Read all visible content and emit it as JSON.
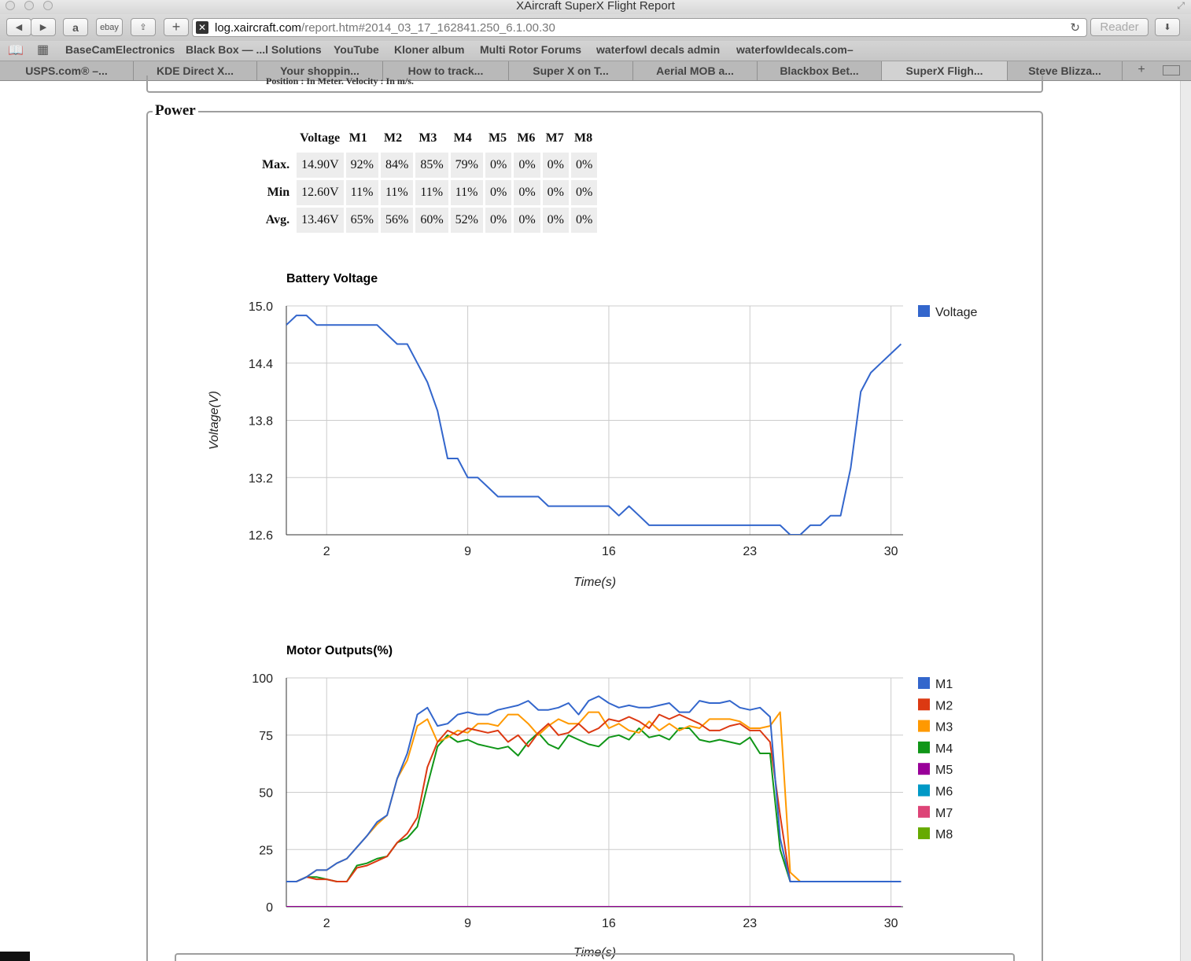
{
  "window": {
    "title": "XAircraft SuperX Flight Report"
  },
  "toolbar": {
    "amazon_label": "a",
    "ebay_label": "ebay",
    "url_host": "log.xaircraft.com",
    "url_rest": "/report.htm#2014_03_17_162841.250_6.1.00.30",
    "reader_label": "Reader"
  },
  "bookmarks": [
    "BaseCamElectronics",
    "Black Box — ...l Solutions",
    "YouTube",
    "Kloner album",
    "Multi Rotor Forums",
    "waterfowl decals admin",
    "waterfowldecals.com–"
  ],
  "tabs": [
    "USPS.com® –...",
    "KDE Direct X...",
    "Your shoppin...",
    "How to track...",
    "Super X on T...",
    "Aerial MOB a...",
    "Blackbox Bet...",
    "SuperX Fligh...",
    "Steve Blizza..."
  ],
  "prev_section_text": "Position : In Meter.     Velocity : In m/s.",
  "power": {
    "legend": "Power",
    "table": {
      "headers": [
        "Voltage",
        "M1",
        "M2",
        "M3",
        "M4",
        "M5",
        "M6",
        "M7",
        "M8"
      ],
      "rows": [
        {
          "label": "Max.",
          "cells": [
            "14.90V",
            "92%",
            "84%",
            "85%",
            "79%",
            "0%",
            "0%",
            "0%",
            "0%"
          ]
        },
        {
          "label": "Min",
          "cells": [
            "12.60V",
            "11%",
            "11%",
            "11%",
            "11%",
            "0%",
            "0%",
            "0%",
            "0%"
          ]
        },
        {
          "label": "Avg.",
          "cells": [
            "13.46V",
            "65%",
            "56%",
            "60%",
            "52%",
            "0%",
            "0%",
            "0%",
            "0%"
          ]
        }
      ]
    }
  },
  "chart_data": [
    {
      "type": "line",
      "title": "Battery Voltage",
      "xlabel": "Time(s)",
      "ylabel": "Voltage(V)",
      "xlim": [
        0,
        30.6
      ],
      "ylim": [
        12.6,
        15.0
      ],
      "xticks": [
        2,
        9,
        16,
        23,
        30
      ],
      "yticks": [
        12.6,
        13.2,
        13.8,
        14.4,
        15.0
      ],
      "grid": true,
      "legend_position": "right",
      "series": [
        {
          "name": "Voltage",
          "color": "#3366cc",
          "x": [
            0,
            0.5,
            1,
            1.5,
            2,
            2.5,
            3,
            3.5,
            4,
            4.5,
            5,
            5.5,
            6,
            6.5,
            7,
            7.5,
            8,
            8.5,
            9,
            9.5,
            10,
            10.5,
            11,
            11.5,
            12,
            12.5,
            13,
            13.5,
            14,
            14.5,
            15,
            15.5,
            16,
            16.5,
            17,
            17.5,
            18,
            18.5,
            19,
            19.5,
            20,
            20.5,
            21,
            21.5,
            22,
            22.5,
            23,
            23.5,
            24,
            24.5,
            25,
            25.5,
            26,
            26.5,
            27,
            27.5,
            28,
            28.5,
            29,
            29.5,
            30,
            30.5
          ],
          "y": [
            14.8,
            14.9,
            14.9,
            14.8,
            14.8,
            14.8,
            14.8,
            14.8,
            14.8,
            14.8,
            14.7,
            14.6,
            14.6,
            14.4,
            14.2,
            13.9,
            13.4,
            13.4,
            13.2,
            13.2,
            13.1,
            13.0,
            13.0,
            13.0,
            13.0,
            13.0,
            12.9,
            12.9,
            12.9,
            12.9,
            12.9,
            12.9,
            12.9,
            12.8,
            12.9,
            12.8,
            12.7,
            12.7,
            12.7,
            12.7,
            12.7,
            12.7,
            12.7,
            12.7,
            12.7,
            12.7,
            12.7,
            12.7,
            12.7,
            12.7,
            12.6,
            12.6,
            12.7,
            12.7,
            12.8,
            12.8,
            13.3,
            14.1,
            14.3,
            14.4,
            14.5,
            14.6
          ]
        }
      ]
    },
    {
      "type": "line",
      "title": "Motor Outputs(%)",
      "xlabel": "Time(s)",
      "ylabel": "",
      "xlim": [
        0,
        30.6
      ],
      "ylim": [
        0,
        100
      ],
      "xticks": [
        2,
        9,
        16,
        23,
        30
      ],
      "yticks": [
        0,
        25,
        50,
        75,
        100
      ],
      "grid": true,
      "legend_position": "right",
      "x": [
        0,
        0.5,
        1,
        1.5,
        2,
        2.5,
        3,
        3.5,
        4,
        4.5,
        5,
        5.5,
        6,
        6.5,
        7,
        7.5,
        8,
        8.5,
        9,
        9.5,
        10,
        10.5,
        11,
        11.5,
        12,
        12.5,
        13,
        13.5,
        14,
        14.5,
        15,
        15.5,
        16,
        16.5,
        17,
        17.5,
        18,
        18.5,
        19,
        19.5,
        20,
        20.5,
        21,
        21.5,
        22,
        22.5,
        23,
        23.5,
        24,
        24.5,
        25,
        25.5,
        26,
        26.5,
        27,
        27.5,
        28,
        28.5,
        29,
        29.5,
        30,
        30.5
      ],
      "series": [
        {
          "name": "M1",
          "color": "#3366cc",
          "values": [
            11,
            11,
            13,
            16,
            16,
            19,
            21,
            26,
            31,
            37,
            40,
            56,
            67,
            84,
            87,
            79,
            80,
            84,
            85,
            84,
            84,
            86,
            87,
            88,
            90,
            86,
            86,
            87,
            89,
            84,
            90,
            92,
            89,
            87,
            88,
            87,
            87,
            88,
            89,
            85,
            85,
            90,
            89,
            89,
            90,
            87,
            86,
            87,
            83,
            30,
            11,
            11,
            11,
            11,
            11,
            11,
            11,
            11,
            11,
            11,
            11,
            11
          ]
        },
        {
          "name": "M2",
          "color": "#dc3912",
          "values": [
            11,
            11,
            13,
            12,
            12,
            11,
            11,
            17,
            18,
            20,
            22,
            28,
            32,
            39,
            61,
            72,
            77,
            75,
            78,
            77,
            76,
            77,
            72,
            75,
            70,
            76,
            80,
            75,
            76,
            80,
            76,
            78,
            82,
            81,
            83,
            81,
            78,
            84,
            82,
            84,
            82,
            80,
            77,
            77,
            79,
            80,
            77,
            77,
            72,
            40,
            11,
            11,
            11,
            11,
            11,
            11,
            11,
            11,
            11,
            11,
            11,
            11
          ]
        },
        {
          "name": "M3",
          "color": "#ff9900",
          "values": [
            11,
            11,
            13,
            16,
            16,
            19,
            21,
            26,
            31,
            36,
            40,
            56,
            64,
            79,
            82,
            72,
            74,
            77,
            76,
            80,
            80,
            79,
            84,
            84,
            80,
            75,
            79,
            82,
            80,
            80,
            85,
            85,
            78,
            80,
            77,
            76,
            81,
            77,
            80,
            77,
            79,
            78,
            82,
            82,
            82,
            81,
            78,
            78,
            79,
            85,
            15,
            11,
            11,
            11,
            11,
            11,
            11,
            11,
            11,
            11,
            11,
            11
          ]
        },
        {
          "name": "M4",
          "color": "#109618",
          "values": [
            11,
            11,
            13,
            13,
            12,
            11,
            11,
            18,
            19,
            21,
            22,
            28,
            30,
            35,
            53,
            70,
            75,
            72,
            73,
            71,
            70,
            69,
            70,
            66,
            72,
            76,
            71,
            69,
            75,
            73,
            71,
            70,
            74,
            75,
            73,
            78,
            74,
            75,
            73,
            78,
            78,
            73,
            72,
            73,
            72,
            71,
            74,
            67,
            67,
            25,
            11,
            11,
            11,
            11,
            11,
            11,
            11,
            11,
            11,
            11,
            11,
            11
          ]
        },
        {
          "name": "M5",
          "color": "#990099",
          "values": [
            0,
            0,
            0,
            0,
            0,
            0,
            0,
            0,
            0,
            0,
            0,
            0,
            0,
            0,
            0,
            0,
            0,
            0,
            0,
            0,
            0,
            0,
            0,
            0,
            0,
            0,
            0,
            0,
            0,
            0,
            0,
            0,
            0,
            0,
            0,
            0,
            0,
            0,
            0,
            0,
            0,
            0,
            0,
            0,
            0,
            0,
            0,
            0,
            0,
            0,
            0,
            0,
            0,
            0,
            0,
            0,
            0,
            0,
            0,
            0,
            0,
            0
          ]
        },
        {
          "name": "M6",
          "color": "#0099c6",
          "values": [
            0,
            0,
            0,
            0,
            0,
            0,
            0,
            0,
            0,
            0,
            0,
            0,
            0,
            0,
            0,
            0,
            0,
            0,
            0,
            0,
            0,
            0,
            0,
            0,
            0,
            0,
            0,
            0,
            0,
            0,
            0,
            0,
            0,
            0,
            0,
            0,
            0,
            0,
            0,
            0,
            0,
            0,
            0,
            0,
            0,
            0,
            0,
            0,
            0,
            0,
            0,
            0,
            0,
            0,
            0,
            0,
            0,
            0,
            0,
            0,
            0,
            0
          ]
        },
        {
          "name": "M7",
          "color": "#dd4477",
          "values": [
            0,
            0,
            0,
            0,
            0,
            0,
            0,
            0,
            0,
            0,
            0,
            0,
            0,
            0,
            0,
            0,
            0,
            0,
            0,
            0,
            0,
            0,
            0,
            0,
            0,
            0,
            0,
            0,
            0,
            0,
            0,
            0,
            0,
            0,
            0,
            0,
            0,
            0,
            0,
            0,
            0,
            0,
            0,
            0,
            0,
            0,
            0,
            0,
            0,
            0,
            0,
            0,
            0,
            0,
            0,
            0,
            0,
            0,
            0,
            0,
            0,
            0
          ]
        },
        {
          "name": "M8",
          "color": "#66aa00",
          "values": [
            0,
            0,
            0,
            0,
            0,
            0,
            0,
            0,
            0,
            0,
            0,
            0,
            0,
            0,
            0,
            0,
            0,
            0,
            0,
            0,
            0,
            0,
            0,
            0,
            0,
            0,
            0,
            0,
            0,
            0,
            0,
            0,
            0,
            0,
            0,
            0,
            0,
            0,
            0,
            0,
            0,
            0,
            0,
            0,
            0,
            0,
            0,
            0,
            0,
            0,
            0,
            0,
            0,
            0,
            0,
            0,
            0,
            0,
            0,
            0,
            0,
            0
          ]
        }
      ]
    }
  ]
}
